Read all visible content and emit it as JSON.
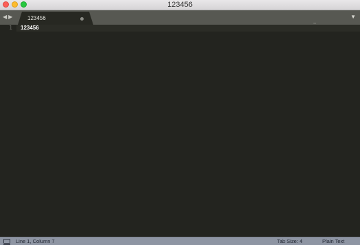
{
  "window": {
    "title": "123456"
  },
  "tabbar": {
    "nav_back_icon": "◀",
    "nav_forward_icon": "▶",
    "tabs": [
      {
        "label": "123456",
        "dirty": true
      }
    ],
    "overflow_icon": "▼"
  },
  "editor": {
    "lines": [
      {
        "number": "1",
        "text": "123456"
      }
    ]
  },
  "statusbar": {
    "position": "Line 1, Column 7",
    "tab_size": "Tab Size: 4",
    "syntax": "Plain Text"
  },
  "colors": {
    "editor_background": "#23241f",
    "tab_bar": "#575852",
    "status_bar": "#8e95a3"
  }
}
